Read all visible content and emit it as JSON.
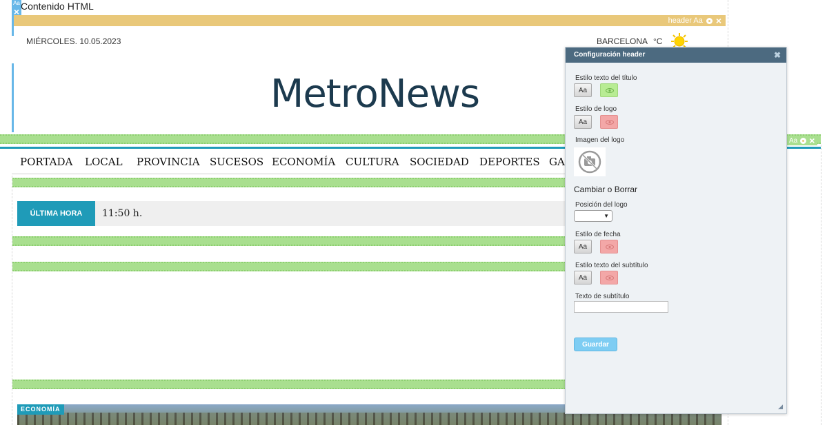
{
  "editor": {
    "widget_tag": "Aa",
    "widget_label": "Contenido HTML",
    "header_strip_label": "header Aa",
    "aa": "Aa"
  },
  "site": {
    "date": "MIÉRCOLES. 10.05.2023",
    "city": "BARCELONA",
    "temp_unit": "°C",
    "logo_text": "MetroNews",
    "nav": [
      "PORTADA",
      "LOCAL",
      "PROVINCIA",
      "SUCESOS",
      "ECONOMÍA",
      "CULTURA",
      "SOCIEDAD",
      "DEPORTES",
      "GA"
    ],
    "breaking_label": "ÚLTIMA HORA",
    "breaking_time": "11:50 h.",
    "category": "ECONOMÍA"
  },
  "panel": {
    "title": "Configuración header",
    "aa_label": "Aa",
    "title_style_label": "Estilo texto del título",
    "logo_style_label": "Estilo de logo",
    "logo_image_label": "Imagen del logo",
    "change_or_delete": "Cambiar o Borrar",
    "logo_position_label": "Posición del logo",
    "date_style_label": "Estilo de fecha",
    "subtitle_style_label": "Estilo texto del subtítulo",
    "subtitle_text_label": "Texto de subtítulo",
    "subtitle_value": "",
    "save_label": "Guardar"
  },
  "colors": {
    "header_strip": "#e9c87a",
    "green_band": "#a9df8f",
    "accent_teal": "#1f9bb8",
    "panel_header": "#4c6a80",
    "save_button": "#7ecdf3"
  },
  "icons": [
    "close-icon",
    "gear-icon",
    "sun-icon",
    "eye-icon",
    "no-image-icon",
    "resize-icon"
  ]
}
